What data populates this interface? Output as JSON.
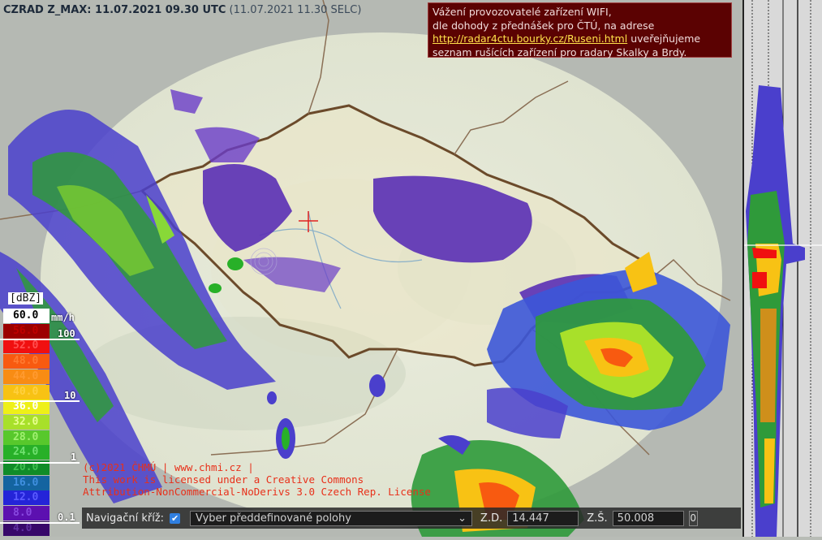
{
  "header": {
    "title": "CZRAD Z_MAX: 11.07.2021 09.30 UTC",
    "local_time": "(11.07.2021 11.30 SELC)"
  },
  "notice": {
    "line1": "Vážení provozovatelé zařízení WIFI,",
    "line2": "dle dohody z přednášek pro ČTÚ, na adrese",
    "link": "http://radar4ctu.bourky.cz/Ruseni.html",
    "line3_rest": " uveřejňujeme",
    "line4": "seznam rušících zařízení pro radary Skalky a Brdy."
  },
  "legend": {
    "unit": "[dBZ]",
    "rain_unit": "mm/h",
    "rows": [
      {
        "label": "60.0",
        "color": "#ffffff",
        "text_color": "#000000"
      },
      {
        "label": "56.0",
        "color": "#9c0000",
        "text_color": "#c00000"
      },
      {
        "label": "52.0",
        "color": "#f01010",
        "text_color": "#ff5050"
      },
      {
        "label": "48.0",
        "color": "#f85a10",
        "text_color": "#ff7a30"
      },
      {
        "label": "44.0",
        "color": "#f88c14",
        "text_color": "#ff9a30"
      },
      {
        "label": "40.0",
        "color": "#f8c214",
        "text_color": "#ffd040"
      },
      {
        "label": "36.0",
        "color": "#eef018",
        "text_color": "#ffffff"
      },
      {
        "label": "32.0",
        "color": "#a8e02a",
        "text_color": "#e8ff90"
      },
      {
        "label": "28.0",
        "color": "#58c82c",
        "text_color": "#a0f070"
      },
      {
        "label": "24.0",
        "color": "#28b028",
        "text_color": "#70e070"
      },
      {
        "label": "20.0",
        "color": "#108c28",
        "text_color": "#40c050"
      },
      {
        "label": "16.0",
        "color": "#1464a0",
        "text_color": "#4090e0"
      },
      {
        "label": "12.0",
        "color": "#2424d8",
        "text_color": "#5a5aff"
      },
      {
        "label": "8.0",
        "color": "#5c10b0",
        "text_color": "#8848e0"
      },
      {
        "label": "4.0",
        "color": "#38086a",
        "text_color": "#6030a0"
      }
    ],
    "rain_marks": [
      "100",
      "10",
      "1",
      "0.1"
    ]
  },
  "license": {
    "line1": "(c)2021 ČHMÚ | www.chmi.cz |",
    "line2": "This work is licensed under a Creative Commons",
    "line3": "Attribution-NonCommercial-NoDerivs 3.0 Czech Rep. License"
  },
  "navbar": {
    "cross_label": "Navigační kříž:",
    "cross_checked": "✔",
    "preset_placeholder": "Vyber předdefinované polohy",
    "lon_label": "Z.D.",
    "lon_value": "14.447",
    "lat_label": "Z.Š.",
    "lat_value": "50.008",
    "zero_button": "0"
  },
  "colors": {
    "notice_bg": "#5b0202",
    "link": "#ffe14a",
    "license_text": "#e8301a",
    "checkbox": "#2f7fe0"
  }
}
